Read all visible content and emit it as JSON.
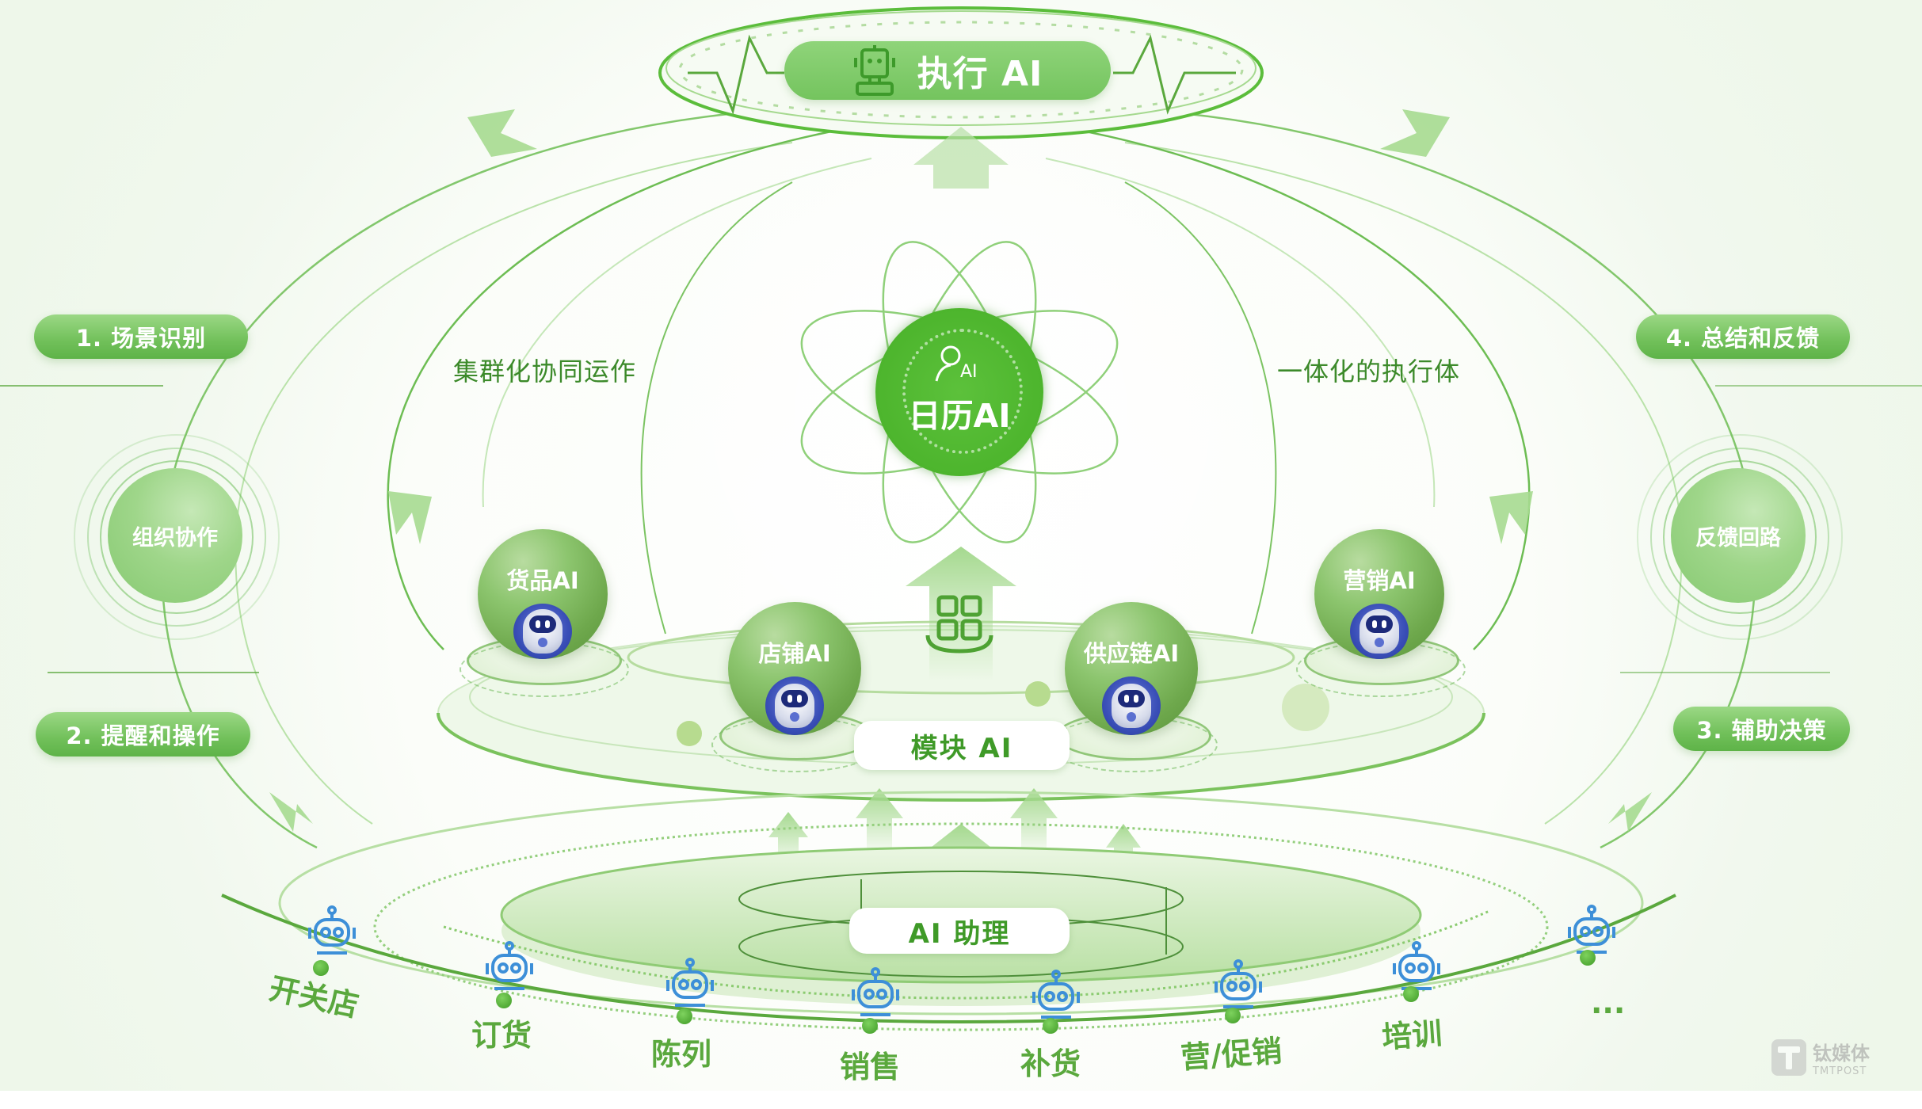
{
  "top": {
    "title": "执行 AI",
    "icon": "robot-icon"
  },
  "core": {
    "title": "日历AI",
    "icon_text": "AI",
    "icon": "user-ai-icon"
  },
  "annotations": {
    "left": "集群化协同运作",
    "right": "一体化的执行体"
  },
  "steps": [
    {
      "label": "1. 场景识别"
    },
    {
      "label": "2. 提醒和操作"
    },
    {
      "label": "3. 辅助决策"
    },
    {
      "label": "4. 总结和反馈"
    }
  ],
  "side_nodes": {
    "left": "组织协作",
    "right": "反馈回路"
  },
  "modules": [
    {
      "label": "货品AI"
    },
    {
      "label": "店铺AI"
    },
    {
      "label": "供应链AI"
    },
    {
      "label": "营销AI"
    }
  ],
  "module_layer": {
    "label": "模块 AI",
    "icon": "grid-apps-icon"
  },
  "assistant_layer": {
    "label": "AI 助理"
  },
  "scenarios": [
    {
      "label": "开关店"
    },
    {
      "label": "订货"
    },
    {
      "label": "陈列"
    },
    {
      "label": "销售"
    },
    {
      "label": "补货"
    },
    {
      "label": "营/促销"
    },
    {
      "label": "培训"
    },
    {
      "label": "..."
    }
  ],
  "watermark": {
    "brand": "钛媒体",
    "sub": "TMTPOST"
  },
  "colors": {
    "primary_green": "#5eb348",
    "core_green": "#4db52d",
    "text_green": "#3f9a28",
    "robot_blue": "#3d8fd8"
  }
}
